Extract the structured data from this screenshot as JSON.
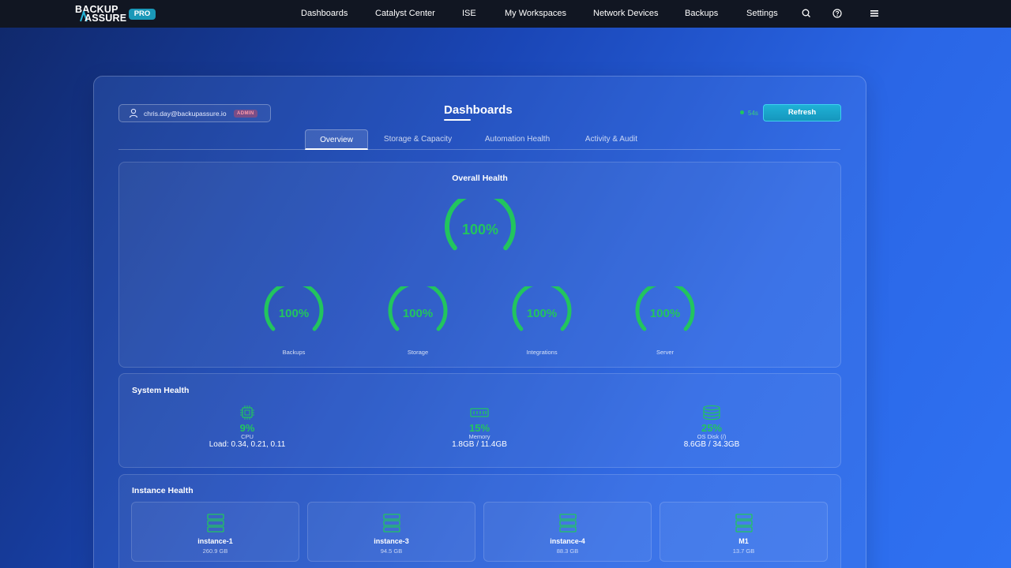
{
  "brand": {
    "line1": "BACKUP",
    "line2": "ASSURE",
    "badge": "PRO"
  },
  "nav": {
    "items": [
      "Dashboards",
      "Catalyst Center",
      "ISE",
      "My Workspaces",
      "Network Devices",
      "Backups",
      "Settings"
    ],
    "icons": [
      "search-icon",
      "help-icon",
      "menu-icon"
    ]
  },
  "user": {
    "email": "chris.day@backupassure.io",
    "role": "ADMIN"
  },
  "page": {
    "title": "Dashboards",
    "timer": "54s",
    "refresh_label": "Refresh"
  },
  "tabs": [
    "Overview",
    "Storage & Capacity",
    "Automation Health",
    "Activity & Audit"
  ],
  "overall": {
    "title": "Overall Health",
    "value": "100%",
    "gauges": [
      {
        "label": "Backups",
        "value": "100%"
      },
      {
        "label": "Storage",
        "value": "100%"
      },
      {
        "label": "Integrations",
        "value": "100%"
      },
      {
        "label": "Server",
        "value": "100%"
      }
    ]
  },
  "system": {
    "title": "System Health",
    "items": [
      {
        "icon": "cpu-icon",
        "pct": "9%",
        "label": "CPU",
        "detail": "Load: 0.34, 0.21, 0.11"
      },
      {
        "icon": "memory-icon",
        "pct": "15%",
        "label": "Memory",
        "detail": "1.8GB / 11.4GB"
      },
      {
        "icon": "disk-icon",
        "pct": "25%",
        "label": "OS Disk (/)",
        "detail": "8.6GB / 34.3GB"
      }
    ]
  },
  "instances": {
    "title": "Instance Health",
    "items": [
      {
        "name": "instance-1",
        "size": "260.9 GB"
      },
      {
        "name": "instance-3",
        "size": "94.5 GB"
      },
      {
        "name": "instance-4",
        "size": "88.3 GB"
      },
      {
        "name": "M1",
        "size": "13.7 GB"
      }
    ]
  },
  "colors": {
    "accent_green": "#22c55e",
    "refresh_button": "#1596bd",
    "navbar_bg": "#111622"
  }
}
